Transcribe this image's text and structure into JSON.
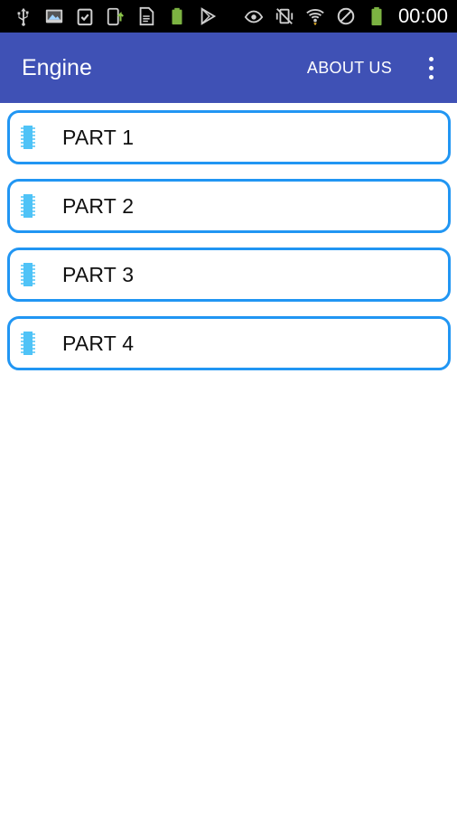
{
  "status_bar": {
    "left_icons": [
      "usb-icon",
      "image-icon",
      "clipboard-check-icon",
      "phone-upload-icon",
      "document-icon",
      "battery-full-icon",
      "play-store-icon"
    ],
    "right_icons": [
      "eye-icon",
      "vibrate-mute-icon",
      "wifi-icon",
      "do-not-disturb-icon",
      "battery-icon"
    ],
    "time": "00:00"
  },
  "app_bar": {
    "title": "Engine",
    "about_label": "ABOUT US",
    "background": "#3f51b5"
  },
  "parts": [
    {
      "label": "PART 1"
    },
    {
      "label": "PART 2"
    },
    {
      "label": "PART 3"
    },
    {
      "label": "PART 4"
    }
  ],
  "colors": {
    "accent_border": "#2196f3",
    "chip_icon": "#4fc3f7"
  }
}
